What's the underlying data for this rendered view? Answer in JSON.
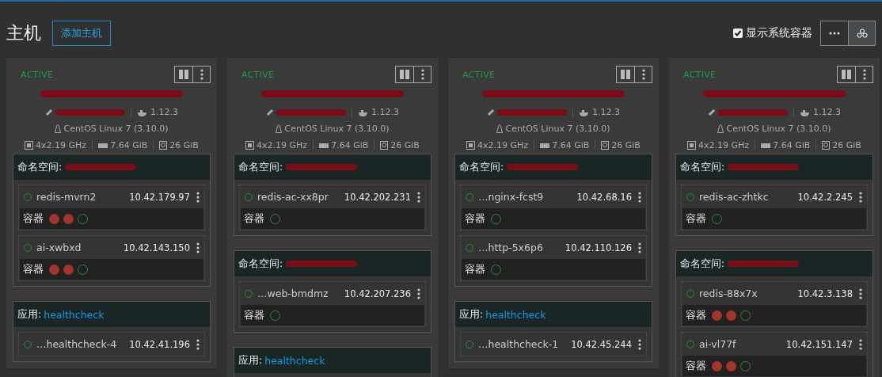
{
  "page": {
    "title": "主机",
    "add_button": "添加主机",
    "show_system": {
      "label": "显示系统容器",
      "checked": true
    },
    "view_buttons": [
      {
        "kind": "more",
        "selected": false
      },
      {
        "kind": "stack",
        "selected": true
      }
    ]
  },
  "hosts": [
    {
      "status": "ACTIVE",
      "docker": "1.12.3",
      "os": "CentOS Linux 7 (3.10.0)",
      "cpu": "4x2.19 GHz",
      "ram": "7.64 GiB",
      "disk": "26 GiB",
      "groups": [
        {
          "kind": "namespace",
          "label": "命名空间:",
          "redacted": true,
          "pods": [
            {
              "name": "redis-mvrn2",
              "ip": "10.42.179.97",
              "container_label": "容器",
              "containers": [
                {
                  "kind": "error"
                },
                {
                  "kind": "error"
                },
                {
                  "kind": "running"
                }
              ]
            },
            {
              "name": "ai-xwbxd",
              "ip": "10.42.143.150",
              "container_label": "容器",
              "containers": [
                {
                  "kind": "error"
                },
                {
                  "kind": "error"
                },
                {
                  "kind": "running"
                }
              ]
            }
          ]
        },
        {
          "kind": "app",
          "label": "应用:",
          "value": "healthcheck",
          "redacted": false,
          "pods": [
            {
              "name": "…healthcheck-4",
              "ip": "10.42.41.196"
            }
          ]
        }
      ]
    },
    {
      "status": "ACTIVE",
      "docker": "1.12.3",
      "os": "CentOS Linux 7 (3.10.0)",
      "cpu": "4x2.19 GHz",
      "ram": "7.64 GiB",
      "disk": "26 GiB",
      "groups": [
        {
          "kind": "namespace",
          "label": "命名空间:",
          "redacted": true,
          "pods": [
            {
              "name": "redis-ac-xx8pr",
              "ip": "10.42.202.231",
              "container_label": "容器",
              "containers": [
                {
                  "kind": "running"
                }
              ]
            }
          ]
        },
        {
          "kind": "namespace",
          "label": "命名空间:",
          "redacted": true,
          "pods": [
            {
              "name": "…web-bmdmz",
              "ip": "10.42.207.236",
              "container_label": "容器",
              "containers": [
                {
                  "kind": "running"
                }
              ]
            }
          ]
        },
        {
          "kind": "app",
          "label": "应用:",
          "value": "healthcheck",
          "redacted": false
        }
      ]
    },
    {
      "status": "ACTIVE",
      "docker": "1.12.3",
      "os": "CentOS Linux 7 (3.10.0)",
      "cpu": "4x2.19 GHz",
      "ram": "7.64 GiB",
      "disk": "26 GiB",
      "groups": [
        {
          "kind": "namespace",
          "label": "命名空间:",
          "redacted": true,
          "pods": [
            {
              "name": "…nginx-fcst9",
              "ip": "10.42.68.16",
              "container_label": "容器",
              "containers": [
                {
                  "kind": "running"
                }
              ]
            },
            {
              "name": "…http-5x6p6",
              "ip": "10.42.110.126",
              "container_label": "容器",
              "containers": [
                {
                  "kind": "running"
                }
              ]
            }
          ]
        },
        {
          "kind": "app",
          "label": "应用:",
          "value": "healthcheck",
          "redacted": false,
          "pods": [
            {
              "name": "…healthcheck-1",
              "ip": "10.42.45.244"
            }
          ]
        }
      ]
    },
    {
      "status": "ACTIVE",
      "docker": "1.12.3",
      "os": "CentOS Linux 7 (3.10.0)",
      "cpu": "4x2.19 GHz",
      "ram": "7.64 GiB",
      "disk": "26 GiB",
      "groups": [
        {
          "kind": "namespace",
          "label": "命名空间:",
          "redacted": true,
          "pods": [
            {
              "name": "redis-ac-zhtkc",
              "ip": "10.42.2.245",
              "container_label": "容器",
              "containers": [
                {
                  "kind": "running"
                }
              ]
            }
          ]
        },
        {
          "kind": "namespace",
          "label": "命名空间:",
          "redacted": true,
          "pods": [
            {
              "name": "redis-88x7x",
              "ip": "10.42.3.138",
              "container_label": "容器",
              "containers": [
                {
                  "kind": "error"
                },
                {
                  "kind": "error"
                },
                {
                  "kind": "running"
                }
              ]
            },
            {
              "name": "ai-vl77f",
              "ip": "10.42.151.147",
              "container_label": "容器",
              "containers": [
                {
                  "kind": "error"
                },
                {
                  "kind": "error"
                },
                {
                  "kind": "running"
                }
              ]
            }
          ]
        }
      ]
    }
  ]
}
